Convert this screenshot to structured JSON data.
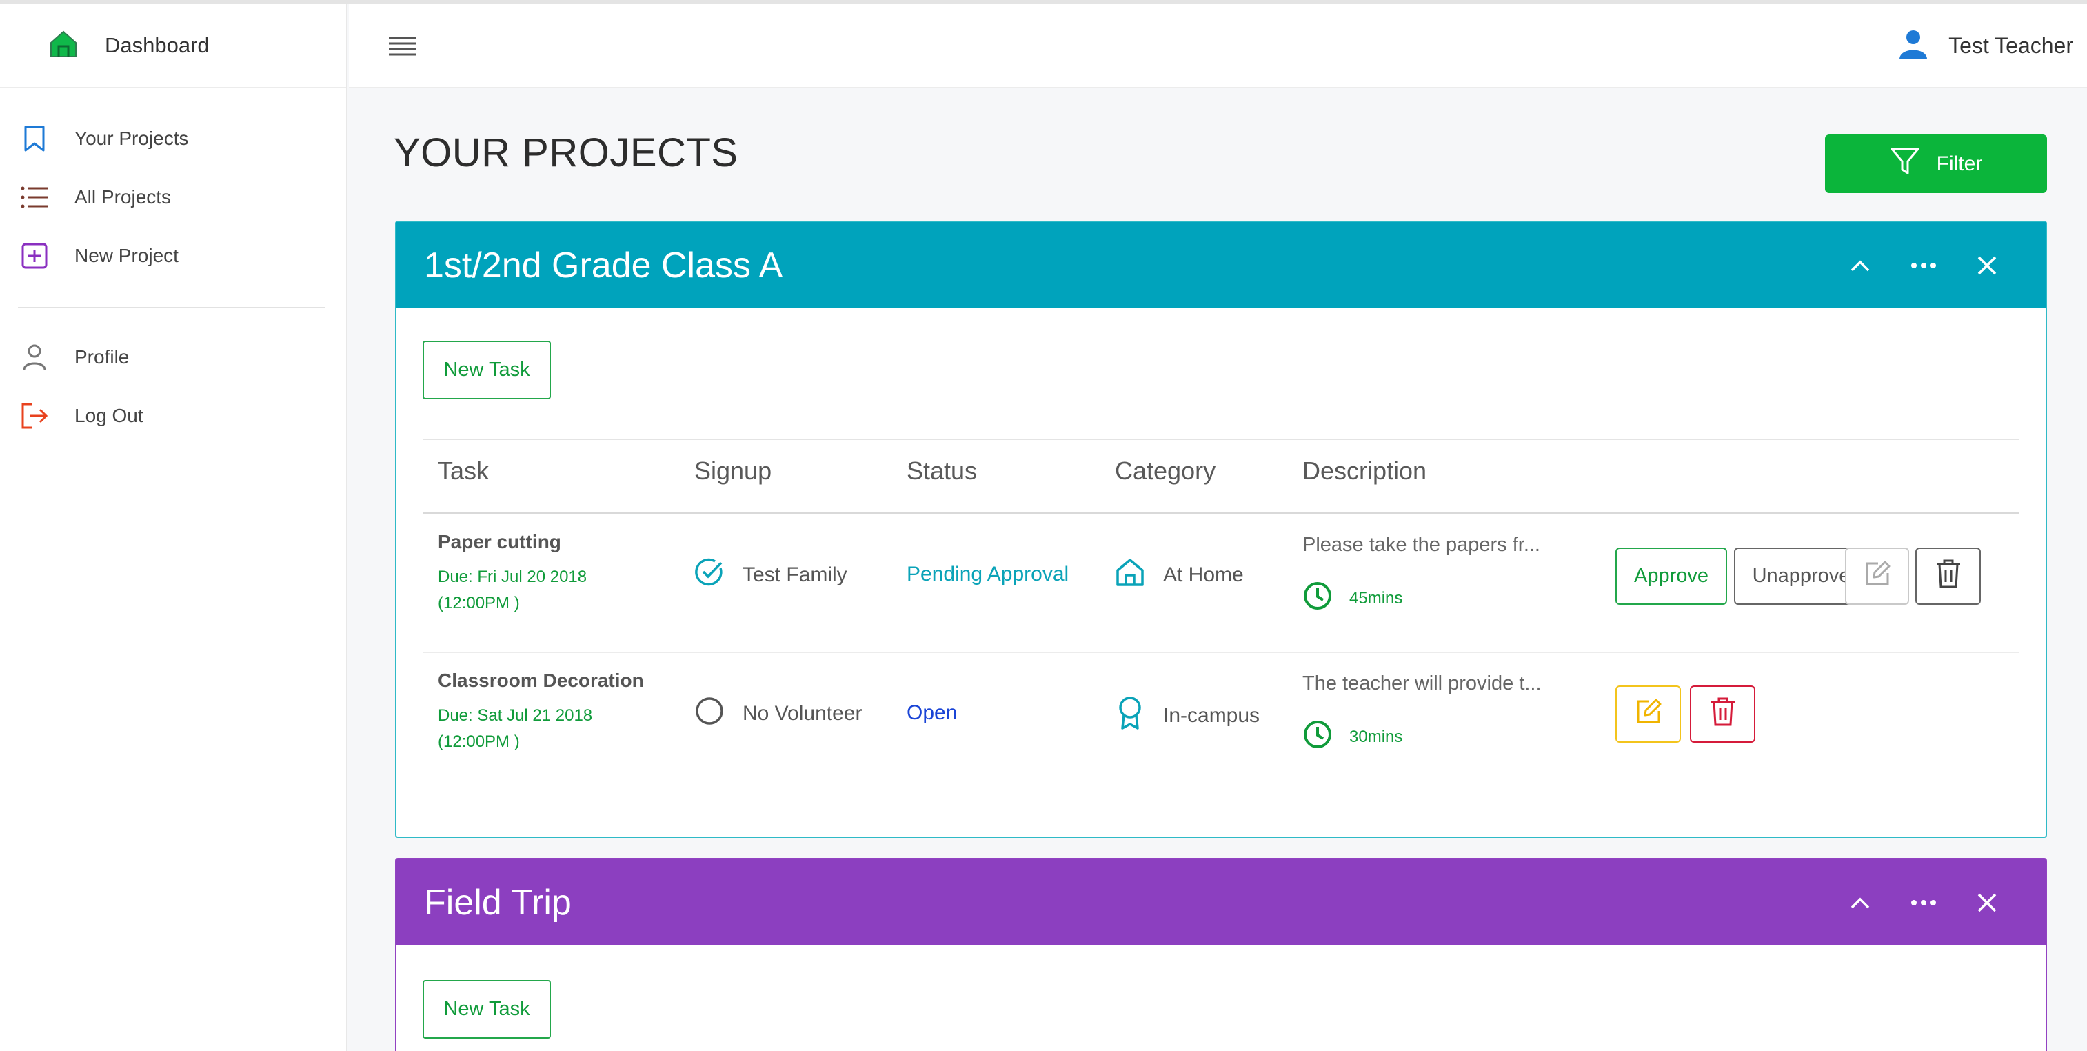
{
  "brand": {
    "label": "Dashboard",
    "icon": "home-icon"
  },
  "sidebar": {
    "items": [
      {
        "label": "Your Projects",
        "icon": "bookmark-icon",
        "color": "#1e7ad6"
      },
      {
        "label": "All Projects",
        "icon": "list-icon",
        "color": "#7a3b2e"
      },
      {
        "label": "New Project",
        "icon": "plus-square-icon",
        "color": "#8a2fc0"
      },
      {
        "label": "Profile",
        "icon": "person-icon",
        "color": "#777777"
      },
      {
        "label": "Log Out",
        "icon": "logout-icon",
        "color": "#e8421e"
      }
    ]
  },
  "topbar": {
    "user_name": "Test Teacher",
    "menu_icon": "hamburger-icon",
    "user_icon": "user-icon"
  },
  "main": {
    "title": "YOUR PROJECTS",
    "filter_label": "Filter"
  },
  "columns": [
    "Task",
    "Signup",
    "Status",
    "Category",
    "Description"
  ],
  "projects": [
    {
      "title": "1st/2nd Grade Class A",
      "color": "#00a3bc",
      "new_task_label": "New Task",
      "tasks": [
        {
          "name": "Paper cutting",
          "due_line1": "Due: Fri Jul 20 2018",
          "due_line2": "(12:00PM )",
          "signup": "Test Family",
          "status": "Pending Approval",
          "status_color": "#0aa3b8",
          "category": "At Home",
          "description": "Please take the papers fr...",
          "duration": "45mins",
          "buttons": {
            "approve": "Approve",
            "unapprove": "Unapprove"
          }
        },
        {
          "name": "Classroom Decoration",
          "due_line1": "Due: Sat Jul 21 2018",
          "due_line2": "(12:00PM )",
          "signup": "No Volunteer",
          "status": "Open",
          "status_color": "#1a44d6",
          "category": "In-campus",
          "description": "The teacher will provide t...",
          "duration": "30mins"
        }
      ]
    },
    {
      "title": "Field Trip",
      "color": "#8c3fc0",
      "new_task_label": "New Task"
    }
  ]
}
